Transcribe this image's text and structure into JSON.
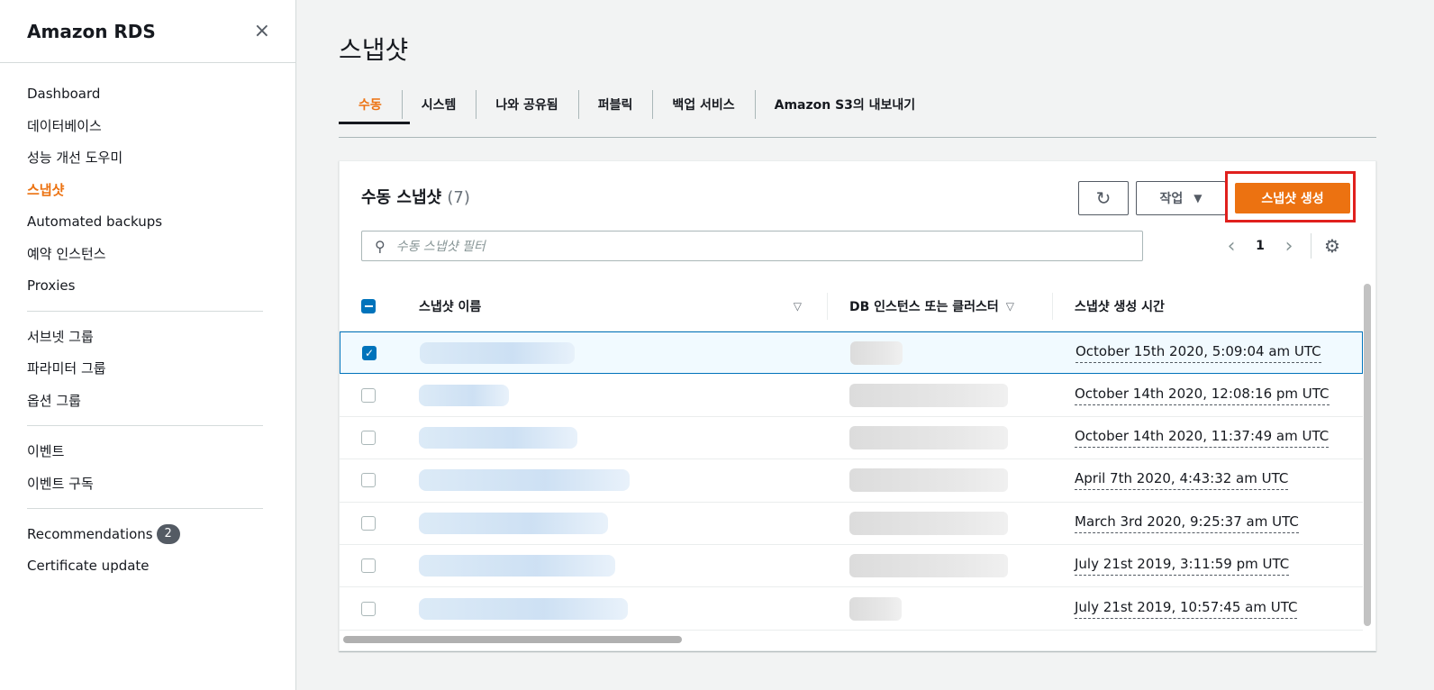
{
  "sidebar": {
    "title": "Amazon RDS",
    "close_icon": "×",
    "groups": [
      [
        {
          "label": "Dashboard",
          "active": false
        },
        {
          "label": "데이터베이스",
          "active": false
        },
        {
          "label": "성능 개선 도우미",
          "active": false
        },
        {
          "label": "스냅샷",
          "active": true
        },
        {
          "label": "Automated backups",
          "active": false
        },
        {
          "label": "예약 인스턴스",
          "active": false
        },
        {
          "label": "Proxies",
          "active": false
        }
      ],
      [
        {
          "label": "서브넷 그룹",
          "active": false
        },
        {
          "label": "파라미터 그룹",
          "active": false
        },
        {
          "label": "옵션 그룹",
          "active": false
        }
      ],
      [
        {
          "label": "이벤트",
          "active": false
        },
        {
          "label": "이벤트 구독",
          "active": false
        }
      ]
    ],
    "recommendations_label": "Recommendations",
    "recommendations_count": "2",
    "certificate_label": "Certificate update"
  },
  "page": {
    "title": "스냅샷",
    "tabs": [
      {
        "label": "수동",
        "active": true
      },
      {
        "label": "시스템",
        "active": false
      },
      {
        "label": "나와 공유됨",
        "active": false
      },
      {
        "label": "퍼블릭",
        "active": false
      },
      {
        "label": "백업 서비스",
        "active": false
      },
      {
        "label": "Amazon S3의 내보내기",
        "active": false
      }
    ]
  },
  "panel": {
    "heading": "수동 스냅샷",
    "count": "(7)",
    "refresh_icon": "↻",
    "action_label": "작업",
    "action_caret": "▼",
    "create_label": "스냅샷 생성",
    "search_icon": "⚲",
    "search_placeholder": "수동 스냅샷 필터",
    "pager": {
      "prev": "‹",
      "page": "1",
      "next": "›",
      "settings_icon": "⚙"
    },
    "columns": {
      "name": "스냅샷 이름",
      "db": "DB 인스턴스 또는 클러스터",
      "time": "스냅샷 생성 시간",
      "sort_icon": "▽"
    },
    "rows": [
      {
        "checked": true,
        "time": "October 15th 2020, 5:09:04 am UTC"
      },
      {
        "checked": false,
        "time": "October 14th 2020, 12:08:16 pm UTC"
      },
      {
        "checked": false,
        "time": "October 14th 2020, 11:37:49 am UTC"
      },
      {
        "checked": false,
        "time": "April 7th 2020, 4:43:32 am UTC"
      },
      {
        "checked": false,
        "time": "March 3rd 2020, 9:25:37 am UTC"
      },
      {
        "checked": false,
        "time": "July 21st 2019, 3:11:59 pm UTC"
      },
      {
        "checked": false,
        "time": "July 21st 2019, 10:57:45 am UTC"
      }
    ]
  },
  "colors": {
    "accent": "#ec7211",
    "selection": "#0073bb",
    "highlight_box": "#e0201d"
  }
}
